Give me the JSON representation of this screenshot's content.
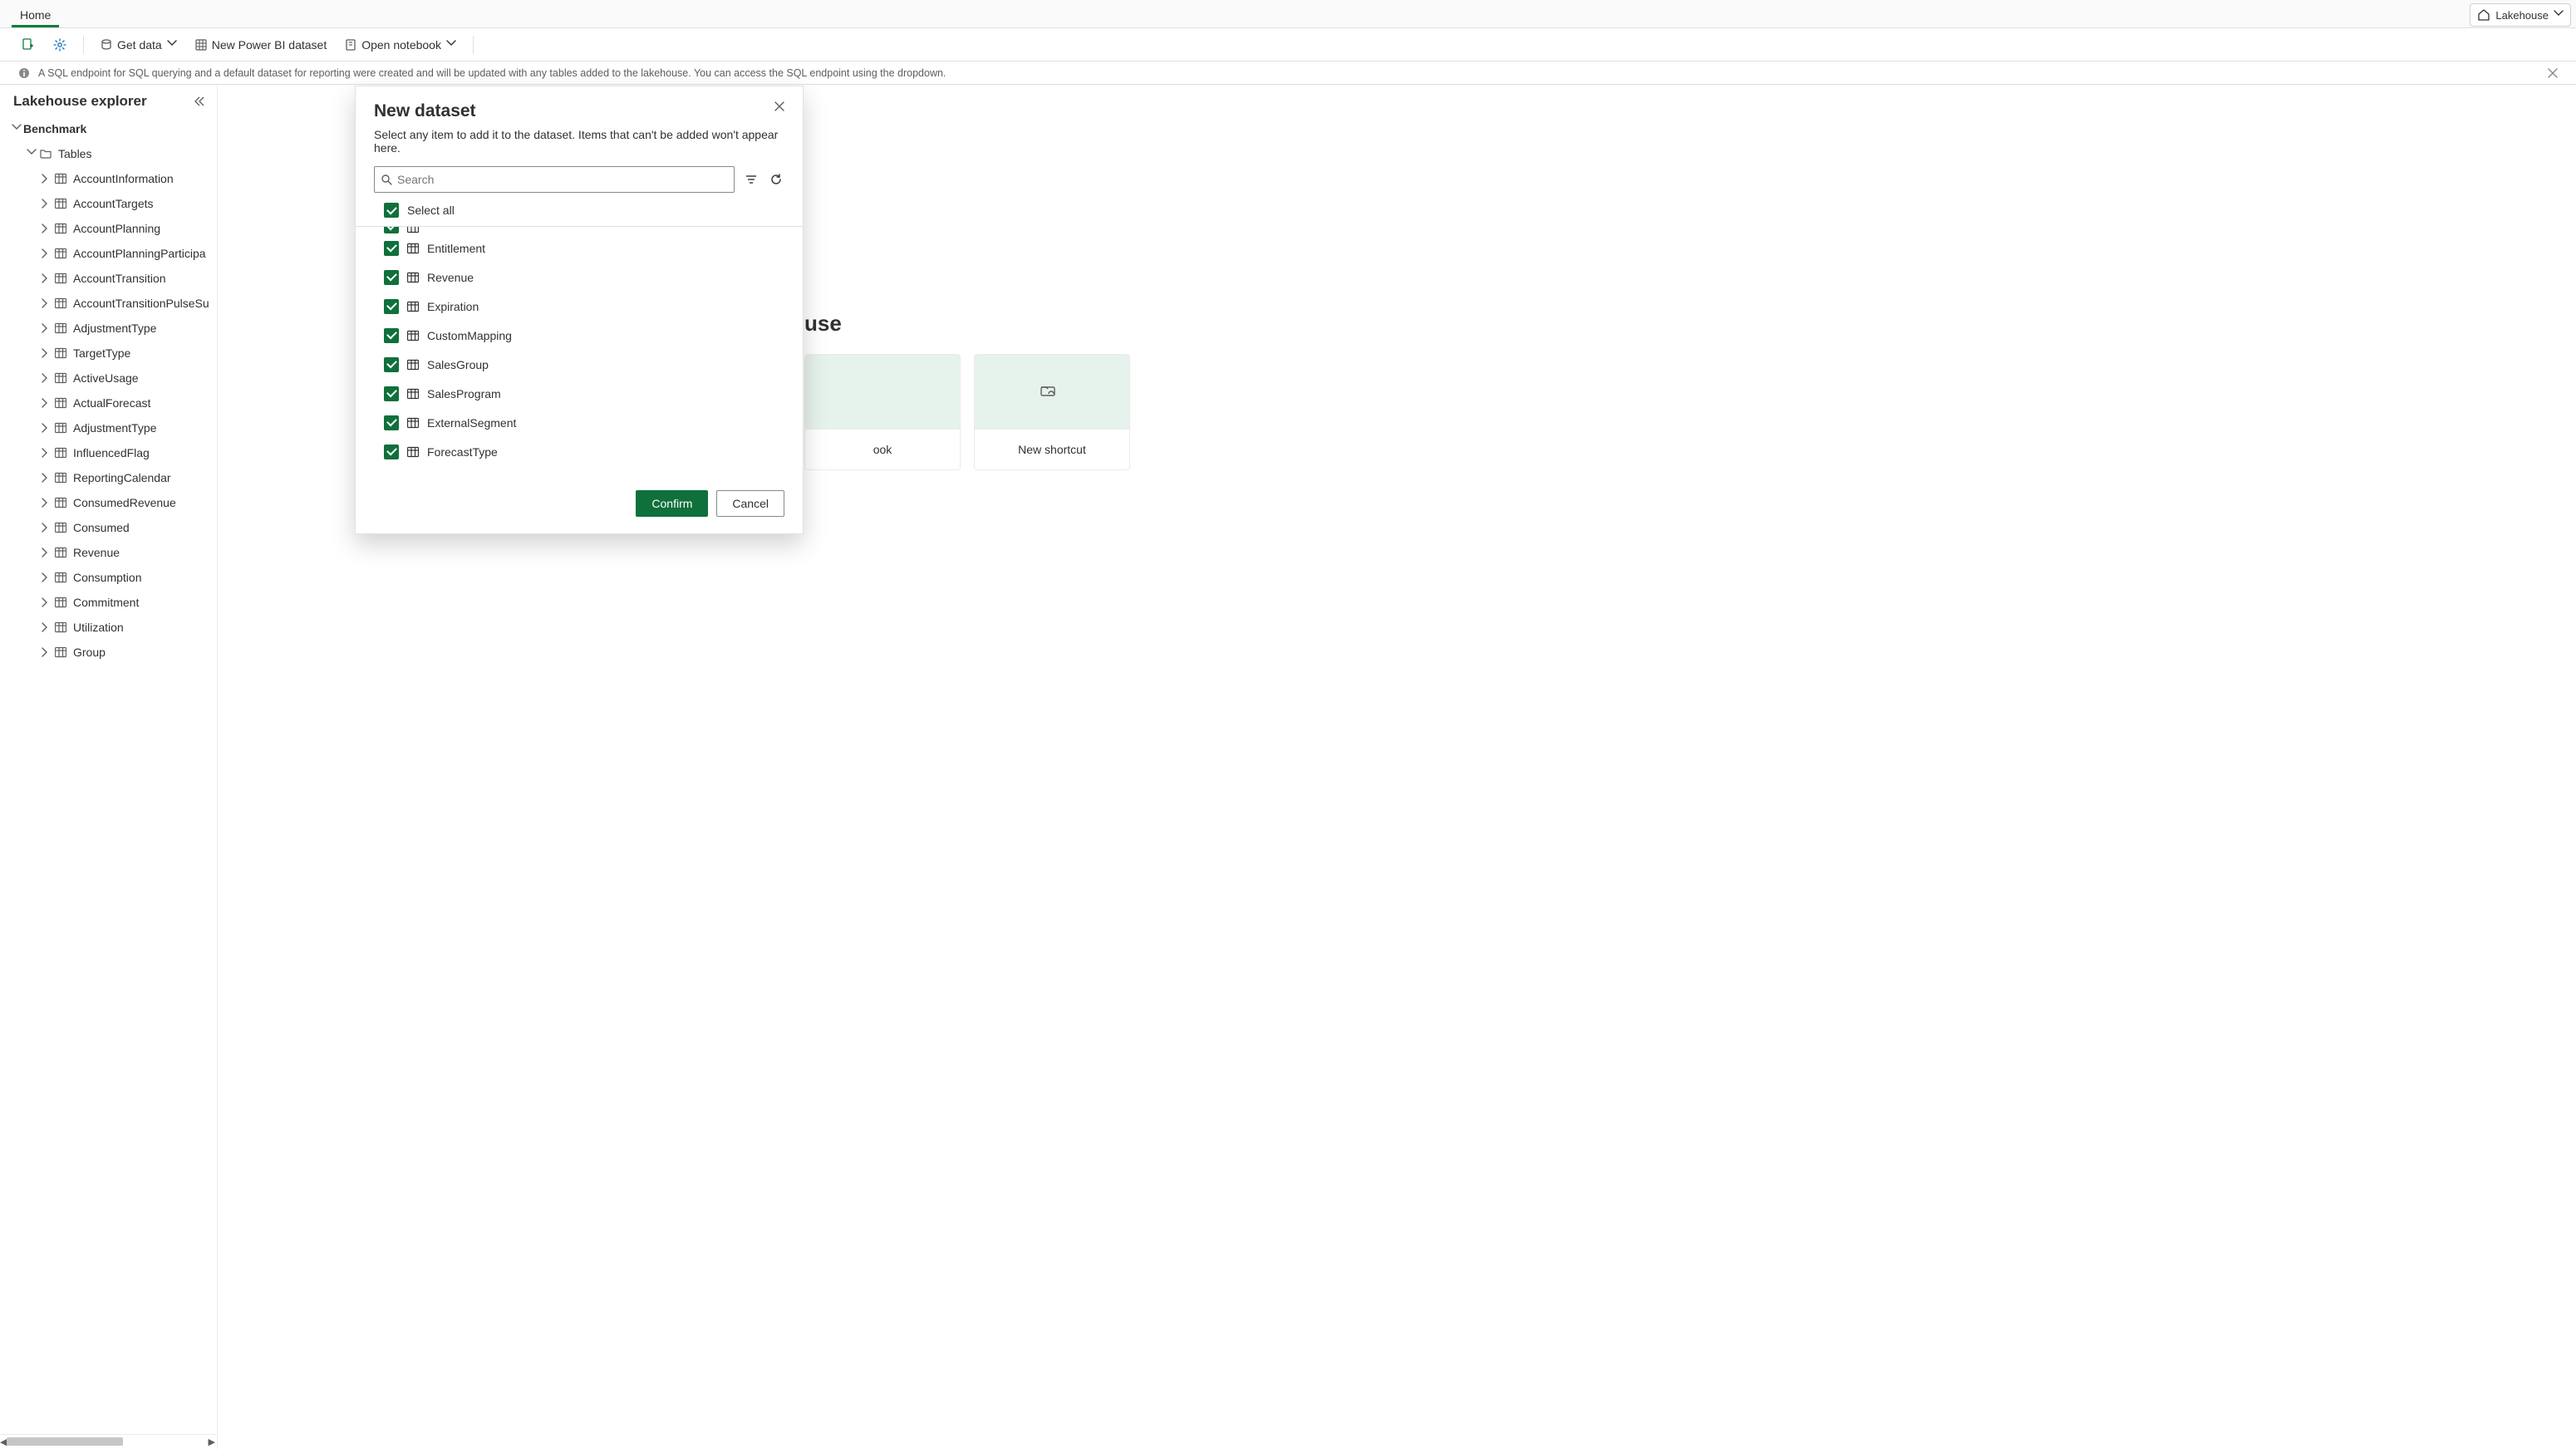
{
  "tabs": {
    "home": "Home"
  },
  "lakehouse_pill": {
    "label": "Lakehouse"
  },
  "ribbon": {
    "get_data": "Get data",
    "new_pbi": "New Power BI dataset",
    "open_notebook": "Open notebook"
  },
  "banner": {
    "text": "A SQL endpoint for SQL querying and a default dataset for reporting were created and will be updated with any tables added to the lakehouse. You can access the SQL endpoint using the dropdown."
  },
  "explorer": {
    "title": "Lakehouse explorer",
    "root": "Benchmark",
    "tables_label": "Tables",
    "tables": [
      "AccountInformation",
      "AccountTargets",
      "AccountPlanning",
      "AccountPlanningParticipa",
      "AccountTransition",
      "AccountTransitionPulseSu",
      "AdjustmentType",
      "TargetType",
      "ActiveUsage",
      "ActualForecast",
      "AdjustmentType",
      "InfluencedFlag",
      "ReportingCalendar",
      "ConsumedRevenue",
      "Consumed",
      "Revenue",
      "Consumption",
      "Commitment",
      "Utilization",
      "Group"
    ]
  },
  "canvas": {
    "heading_suffix": "use",
    "card_notebook_suffix": "ook",
    "card_shortcut": "New shortcut"
  },
  "dialog": {
    "title": "New dataset",
    "subtitle": "Select any item to add it to the dataset. Items that can't be added won't appear here.",
    "search_placeholder": "Search",
    "select_all": "Select all",
    "items": [
      "Entitlement",
      "Revenue",
      "Expiration",
      "CustomMapping",
      "SalesGroup",
      "SalesProgram",
      "ExternalSegment",
      "ForecastType"
    ],
    "confirm": "Confirm",
    "cancel": "Cancel"
  }
}
